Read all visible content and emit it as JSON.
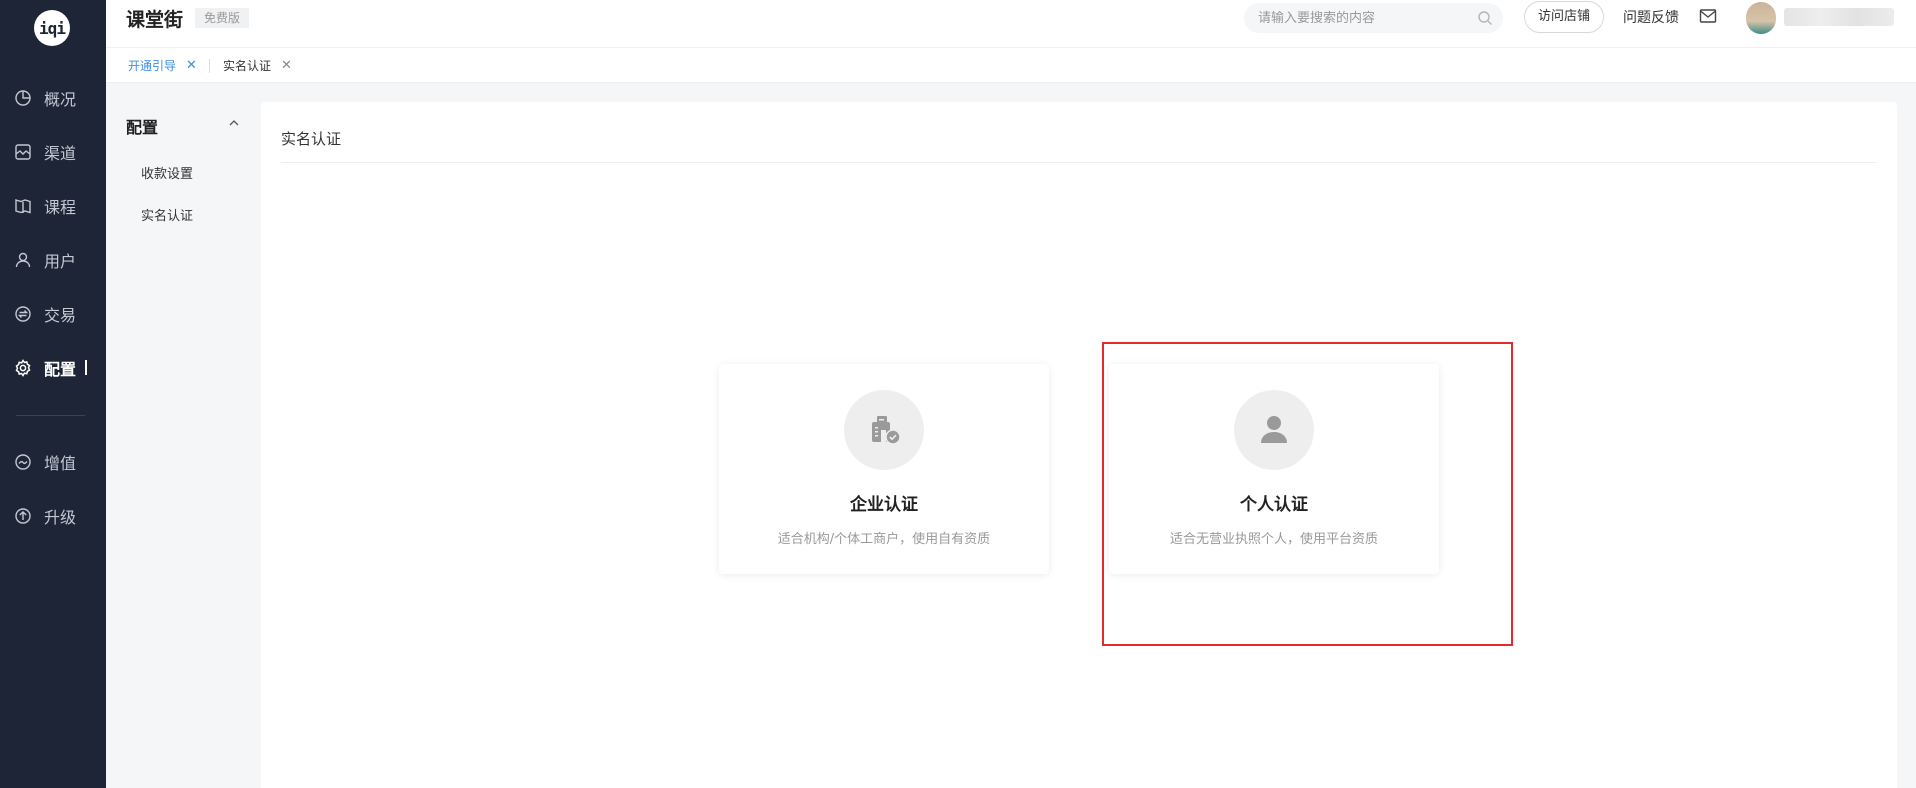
{
  "app": {
    "logo_text": "iqi",
    "title": "课堂街",
    "plan_badge": "免费版"
  },
  "nav": {
    "items": [
      {
        "label": "概况",
        "icon": "pie-chart-icon"
      },
      {
        "label": "渠道",
        "icon": "channel-icon"
      },
      {
        "label": "课程",
        "icon": "book-icon"
      },
      {
        "label": "用户",
        "icon": "user-icon"
      },
      {
        "label": "交易",
        "icon": "exchange-icon"
      },
      {
        "label": "配置",
        "icon": "gear-icon",
        "active": true
      },
      {
        "label": "增值",
        "icon": "value-added-icon"
      },
      {
        "label": "升级",
        "icon": "upgrade-icon"
      }
    ]
  },
  "header": {
    "search_placeholder": "请输入要搜索的内容",
    "visit_store": "访问店铺",
    "feedback": "问题反馈"
  },
  "tabs": [
    {
      "label": "开通引导",
      "active": true
    },
    {
      "label": "实名认证",
      "active": false
    }
  ],
  "submenu": {
    "title": "配置",
    "items": [
      "收款设置",
      "实名认证"
    ]
  },
  "main": {
    "title": "实名认证",
    "cards": [
      {
        "title": "企业认证",
        "desc": "适合机构/个体工商户，使用自有资质",
        "icon": "building-check-icon"
      },
      {
        "title": "个人认证",
        "desc": "适合无营业执照个人，使用平台资质",
        "icon": "person-icon",
        "highlighted": true
      }
    ]
  },
  "colors": {
    "nav_bg": "#1d2536",
    "accent": "#3a8ee6",
    "highlight": "#e8282b"
  }
}
